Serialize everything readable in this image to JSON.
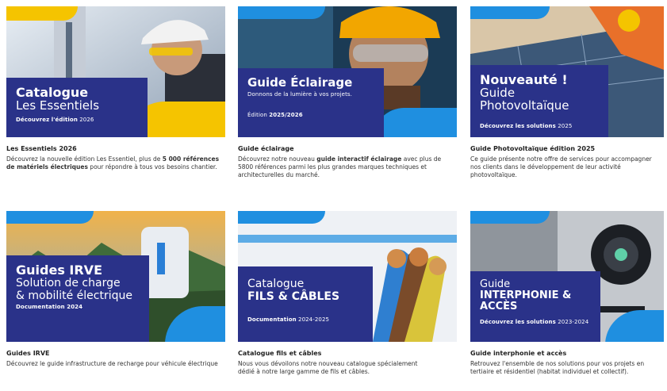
{
  "cards": [
    {
      "thumb": {
        "line1": "Catalogue",
        "line2": "Les Essentiels",
        "small_pre": "Découvrez l'édition",
        "small_post": " 2026"
      },
      "title": "Les Essentiels 2026",
      "desc": {
        "p1": "Découvrez la nouvelle édition Les Essentiel, plus de ",
        "b1": "5 000 références de matériels électriques",
        "p2": " pour répondre à tous vos besoins chantier."
      }
    },
    {
      "thumb": {
        "line1": "Guide Éclairage",
        "line2": "Donnons de la lumière à vos projets.",
        "small_pre": "Édition ",
        "small_post": "2025/2026"
      },
      "title": "Guide éclairage",
      "desc": {
        "p1": "Découvrez notre nouveau ",
        "b1": "guide interactif éclairage",
        "p2": " avec plus de 5800 références parmi les plus grandes marques techniques et architecturelles du marché."
      }
    },
    {
      "thumb": {
        "line1": "Nouveauté !",
        "line2": "Guide Photovoltaïque",
        "small_pre": "Découvrez les solutions",
        "small_post": " 2025"
      },
      "title": "Guide Photovoltaïque édition 2025",
      "desc": {
        "p1": "Ce guide présente notre offre de services pour accompagner nos clients dans le développement de leur activité photovoltaïque."
      }
    },
    {
      "thumb": {
        "line1": "Guides IRVE",
        "line2": "Solution de charge",
        "line3": "& mobilité électrique",
        "small_pre": "Documentation 2024",
        "small_post": ""
      },
      "title": "Guides IRVE",
      "desc": {
        "p1": "Découvrez le guide infrastructure de recharge pour véhicule électrique"
      }
    },
    {
      "thumb": {
        "line1": "Catalogue",
        "line2": "FILS & CÂBLES",
        "small_pre": "Documentation",
        "small_post": " 2024-2025"
      },
      "title": "Catalogue fils et câbles",
      "desc": {
        "p1": "Nous vous dévoilons notre nouveau catalogue spécialement dédié à notre large gamme de fils et câbles."
      }
    },
    {
      "thumb": {
        "line1": "Guide",
        "line2": "INTERPHONIE &",
        "line3": "ACCÈS",
        "small_pre": "Découvrez les solutions",
        "small_post": " 2023-2024"
      },
      "title": "Guide interphonie et accès",
      "desc": {
        "p1": "Retrouvez l'ensemble de nos solutions pour vos projets en tertiaire et résidentiel (habitat individuel et collectif)."
      }
    }
  ]
}
